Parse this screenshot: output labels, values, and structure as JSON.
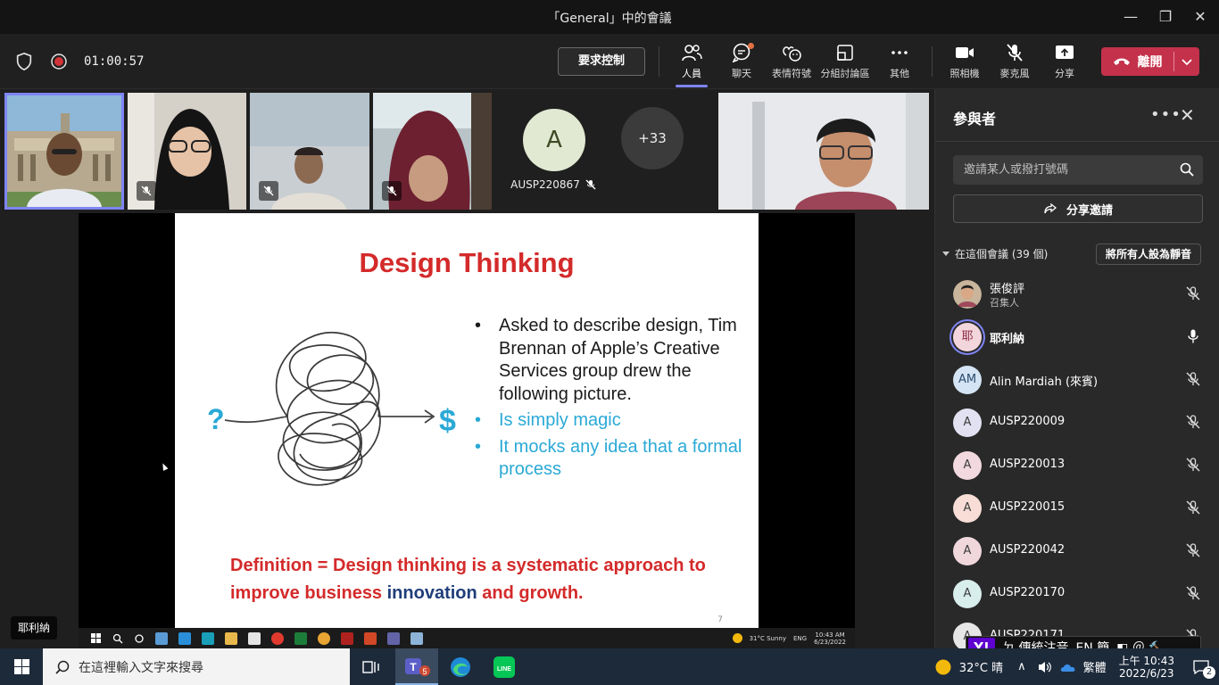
{
  "window": {
    "title": "「General」中的會議",
    "minimize": "—",
    "maximize": "❐",
    "close": "✕"
  },
  "toolbar": {
    "timer": "01:00:57",
    "request_control": "要求控制",
    "items": [
      {
        "label": "人員"
      },
      {
        "label": "聊天"
      },
      {
        "label": "表情符號"
      },
      {
        "label": "分組討論區"
      },
      {
        "label": "其他"
      },
      {
        "label": "照相機"
      },
      {
        "label": "麥克風"
      },
      {
        "label": "分享"
      }
    ],
    "leave": "離開"
  },
  "video_strip": {
    "avatar_initial": "A",
    "avatar_name": "AUSP220867",
    "more_count": "+33"
  },
  "slide": {
    "title": "Design Thinking",
    "question_mark": "?",
    "dollar_mark": "$",
    "bullets_black": [
      "Asked to describe design, Tim Brennan of Apple’s Creative Services group drew the following picture."
    ],
    "bullets_blue": [
      "Is simply magic",
      "It mocks any idea that a formal process"
    ],
    "definition_part1": "Definition = Design thinking is a systematic approach to improve business ",
    "definition_innovation": "innovation",
    "definition_part2": " and growth.",
    "page_number": "7"
  },
  "inner_taskbar": {
    "weather": "31°C Sunny",
    "lang": "ENG",
    "time": "10:43 AM",
    "date": "6/23/2022"
  },
  "speaker_label": "耶利納",
  "panel": {
    "title": "參與者",
    "search_placeholder": "邀請某人或撥打號碼",
    "share_invite": "分享邀請",
    "section": "在這個會議 (39 個)",
    "mute_all": "將所有人設為靜音",
    "participants": [
      {
        "initials": "",
        "name": "張俊評",
        "role": "召集人",
        "color": "#c9b59c"
      },
      {
        "initials": "耶",
        "name": "耶利納",
        "role": "",
        "color": "#f3d6dd"
      },
      {
        "initials": "AM",
        "name": "Alin Mardiah (來賓)",
        "role": "",
        "color": "#d4e4f4"
      },
      {
        "initials": "A",
        "name": "AUSP220009",
        "role": "",
        "color": "#e2e1f2"
      },
      {
        "initials": "A",
        "name": "AUSP220013",
        "role": "",
        "color": "#f2d9df"
      },
      {
        "initials": "A",
        "name": "AUSP220015",
        "role": "",
        "color": "#f7ddd6"
      },
      {
        "initials": "A",
        "name": "AUSP220042",
        "role": "",
        "color": "#f0d7dc"
      },
      {
        "initials": "A",
        "name": "AUSP220170",
        "role": "",
        "color": "#d8eeec"
      },
      {
        "initials": "A",
        "name": "AUSP220171",
        "role": "",
        "color": "#e6e6e6"
      }
    ]
  },
  "ime": {
    "logo": "Y!",
    "mode": "ㄉ 傳統注音",
    "lang": "EN 簡",
    "extra": "◧ ＠ 🔨"
  },
  "taskbar": {
    "search_placeholder": "在這裡輸入文字來搜尋",
    "weather": "32°C 晴",
    "ime": "繁體",
    "time": "上午 10:43",
    "date": "2022/6/23",
    "notifications": "2",
    "teams_badge": "5"
  },
  "colors": {
    "accent": "#7f85f5",
    "leave": "#c4314b",
    "slide_red": "#d42a2a",
    "slide_blue": "#2aa9d6"
  }
}
